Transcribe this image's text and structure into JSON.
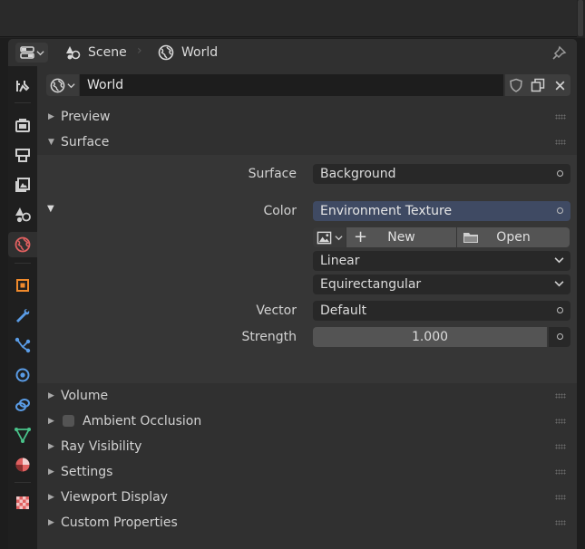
{
  "header": {
    "scene_label": "Scene",
    "world_label": "World",
    "editor_type_icon": "properties-editor-icon",
    "pin_icon": "pin-icon"
  },
  "tabs": [
    {
      "name": "tool",
      "icon": "tool-icon",
      "color": "#c9c9c9"
    },
    {
      "name": "render",
      "icon": "render-icon",
      "color": "#c9c9c9"
    },
    {
      "name": "output",
      "icon": "output-icon",
      "color": "#c9c9c9"
    },
    {
      "name": "view-layer",
      "icon": "view-layer-icon",
      "color": "#c9c9c9"
    },
    {
      "name": "scene",
      "icon": "scene-icon",
      "color": "#c9c9c9"
    },
    {
      "name": "world",
      "icon": "world-icon",
      "color": "#e06060",
      "active": true
    },
    {
      "name": "object",
      "icon": "object-icon",
      "color": "#f08a2c"
    },
    {
      "name": "modifier",
      "icon": "modifier-icon",
      "color": "#5a9ce6"
    },
    {
      "name": "particles",
      "icon": "particles-icon",
      "color": "#5a9ce6"
    },
    {
      "name": "physics",
      "icon": "physics-icon",
      "color": "#5a9ce6"
    },
    {
      "name": "constraints",
      "icon": "constraints-icon",
      "color": "#5a9ce6"
    },
    {
      "name": "data",
      "icon": "data-icon",
      "color": "#49c28a"
    },
    {
      "name": "material",
      "icon": "material-icon",
      "color": "#e06060"
    },
    {
      "name": "texture",
      "icon": "texture-icon",
      "color": "#e06060"
    }
  ],
  "world_id": {
    "name": "World"
  },
  "panels": {
    "preview": "Preview",
    "surface": "Surface",
    "volume": "Volume",
    "ambient_occlusion": "Ambient Occlusion",
    "ray_visibility": "Ray Visibility",
    "settings": "Settings",
    "viewport_display": "Viewport Display",
    "custom_properties": "Custom Properties"
  },
  "surface": {
    "surface_label": "Surface",
    "surface_value": "Background",
    "color_label": "Color",
    "color_value": "Environment Texture",
    "new_label": "New",
    "open_label": "Open",
    "interpolation": "Linear",
    "projection": "Equirectangular",
    "vector_label": "Vector",
    "vector_value": "Default",
    "strength_label": "Strength",
    "strength_value": "1.000"
  },
  "colors": {
    "accent_selected": "#3f4a63",
    "world_tab": "#e06060"
  }
}
